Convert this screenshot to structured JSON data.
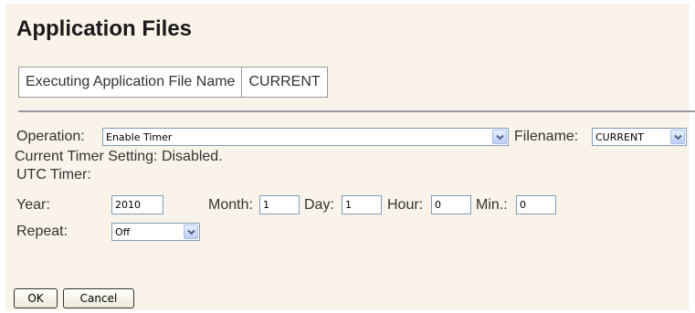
{
  "page": {
    "title": "Application Files"
  },
  "executing": {
    "label": "Executing Application File Name",
    "value": "CURRENT"
  },
  "operation": {
    "label": "Operation:",
    "selected": "Enable Timer"
  },
  "filename": {
    "label": "Filename:",
    "selected": "CURRENT"
  },
  "timer": {
    "current_setting": "Current Timer Setting: Disabled.",
    "utc_label": "UTC Timer:",
    "year_label": "Year:",
    "year_value": "2010",
    "month_label": "Month:",
    "month_value": "1",
    "day_label": "Day:",
    "day_value": "1",
    "hour_label": "Hour:",
    "hour_value": "0",
    "min_label": "Min.:",
    "min_value": "0",
    "repeat_label": "Repeat:",
    "repeat_selected": "Off"
  },
  "buttons": {
    "ok": "OK",
    "cancel": "Cancel"
  },
  "colors": {
    "panel_bg": "#f9f3ea",
    "input_border": "#7f9db9",
    "dropdown_arrow": "#4d6185"
  },
  "icons": {
    "dropdown": "chevron-down-icon"
  }
}
